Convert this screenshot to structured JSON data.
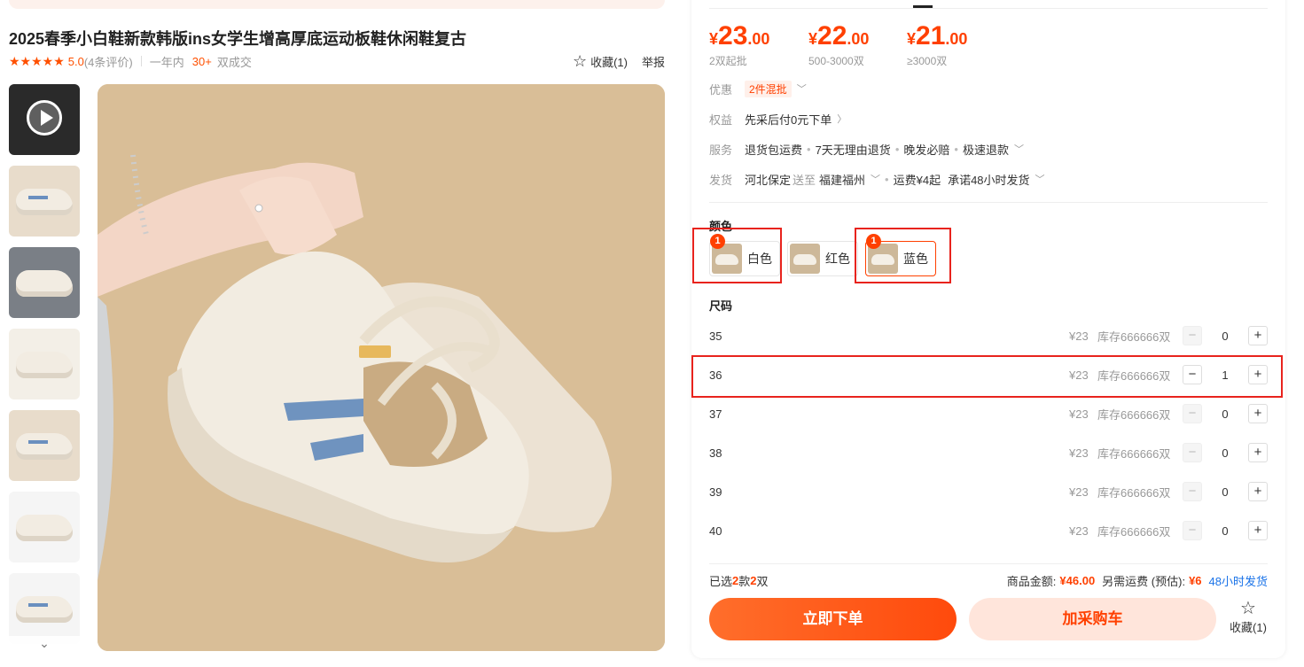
{
  "product": {
    "title": "2025春季小白鞋新款韩版ins女学生增高厚底运动板鞋休闲鞋复古",
    "stars": "★★★★★",
    "rating": "5.0",
    "review_count": "(4条评价)",
    "period": "一年内",
    "deals_count": "30+",
    "deals_label": "双成交",
    "favorite_label": "收藏(1)",
    "report_label": "举报"
  },
  "gallery": {
    "scroll_down_icon": "chevron-down-icon"
  },
  "prices": [
    {
      "yen": "¥",
      "int": "23",
      "dec": ".00",
      "note": "2双起批"
    },
    {
      "yen": "¥",
      "int": "22",
      "dec": ".00",
      "note": "500-3000双"
    },
    {
      "yen": "¥",
      "int": "21",
      "dec": ".00",
      "note": "≥3000双"
    }
  ],
  "info": {
    "discount_label": "优惠",
    "discount_tag": "2件混批",
    "rights_label": "权益",
    "rights_value": "先采后付0元下单",
    "service_label": "服务",
    "services": [
      "退货包运费",
      "7天无理由退货",
      "晚发必赔",
      "极速退款"
    ],
    "ship_label": "发货",
    "ship_from": "河北保定",
    "ship_to_label": "送至",
    "ship_to": "福建福州",
    "ship_fee": "运费¥4起",
    "ship_promise": "承诺48小时发货"
  },
  "colors": {
    "section_label": "颜色",
    "options": [
      {
        "name": "白色",
        "count": "1"
      },
      {
        "name": "红色",
        "count": ""
      },
      {
        "name": "蓝色",
        "count": "1"
      }
    ]
  },
  "sizes": {
    "section_label": "尺码",
    "rows": [
      {
        "size": "35",
        "price": "¥23",
        "stock": "库存666666双",
        "qty": "0"
      },
      {
        "size": "36",
        "price": "¥23",
        "stock": "库存666666双",
        "qty": "1"
      },
      {
        "size": "37",
        "price": "¥23",
        "stock": "库存666666双",
        "qty": "0"
      },
      {
        "size": "38",
        "price": "¥23",
        "stock": "库存666666双",
        "qty": "0"
      },
      {
        "size": "39",
        "price": "¥23",
        "stock": "库存666666双",
        "qty": "0"
      },
      {
        "size": "40",
        "price": "¥23",
        "stock": "库存666666双",
        "qty": "0"
      }
    ],
    "minus": "−",
    "plus": "+"
  },
  "summary": {
    "selected_prefix": "已选",
    "kinds": "2",
    "kinds_unit": "款",
    "pairs": "2",
    "pairs_unit": "双",
    "amount_label": "商品金额:",
    "amount": "¥46.00",
    "shipping_label": "另需运费 (预估):",
    "shipping": "¥6",
    "delivery": "48小时发货"
  },
  "actions": {
    "buy_now": "立即下单",
    "add_cart": "加采购车",
    "favorite": "收藏(1)"
  },
  "colors_theme": {
    "accent": "#ff4000",
    "highlight_box": "#e8231d",
    "link": "#1a73e8"
  }
}
